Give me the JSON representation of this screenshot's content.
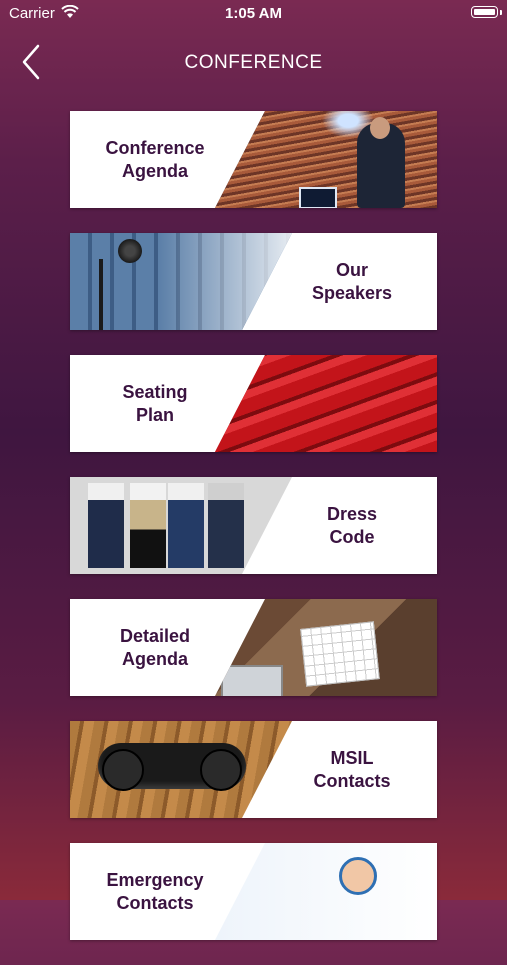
{
  "status": {
    "carrier": "Carrier",
    "time": "1:05 AM"
  },
  "nav": {
    "title": "CONFERENCE"
  },
  "menu": [
    {
      "label": "Conference\nAgenda"
    },
    {
      "label": "Our\nSpeakers"
    },
    {
      "label": "Seating\nPlan"
    },
    {
      "label": "Dress\nCode"
    },
    {
      "label": "Detailed\nAgenda"
    },
    {
      "label": "MSIL\nContacts"
    },
    {
      "label": "Emergency\nContacts"
    }
  ],
  "colors": {
    "label_text": "#3a1340",
    "gradient_top": "#7a2a52",
    "gradient_mid": "#3f1640",
    "gradient_bottom": "#8a2a3a"
  }
}
